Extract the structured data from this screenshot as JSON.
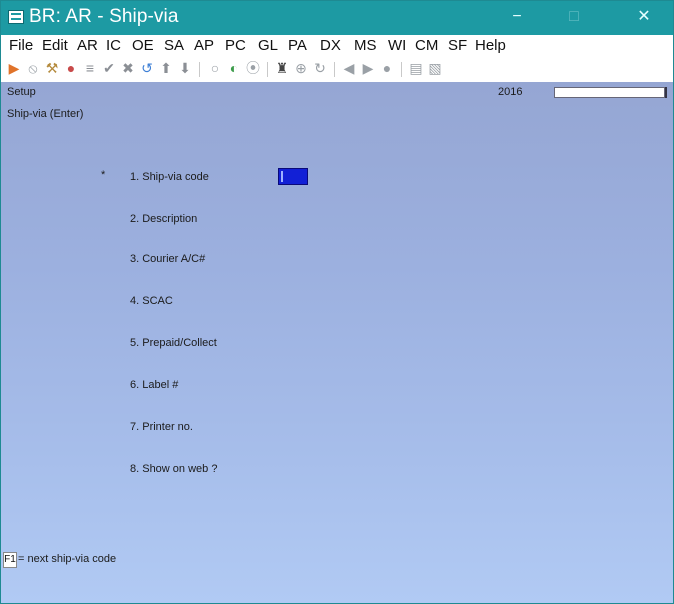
{
  "window": {
    "title": "BR: AR - Ship-via",
    "minimize_glyph": "−",
    "maximize_glyph": "□",
    "close_glyph": "✕"
  },
  "menu": [
    "File",
    "Edit",
    "AR",
    "IC",
    "OE",
    "SA",
    "AP",
    "PC",
    "GL",
    "PA",
    "DX",
    "MS",
    "WI",
    "CM",
    "SF",
    "Help"
  ],
  "toolbar_icons": [
    {
      "name": "run-icon",
      "glyph": "▶",
      "color": "#e0732a"
    },
    {
      "name": "cancel-icon",
      "glyph": "⦸",
      "color": "#9aa0a6"
    },
    {
      "name": "tools-icon",
      "glyph": "⚒",
      "color": "#b48a3c"
    },
    {
      "name": "globe-icon",
      "glyph": "●",
      "color": "#c84a4a"
    },
    {
      "name": "list-icon",
      "glyph": "≡",
      "color": "#8b8f95"
    },
    {
      "name": "check-icon",
      "glyph": "✔",
      "color": "#8b8f95"
    },
    {
      "name": "delete-icon",
      "glyph": "✖",
      "color": "#8b8f95"
    },
    {
      "name": "undo-icon",
      "glyph": "↺",
      "color": "#3d7fd6"
    },
    {
      "name": "arrow-up-icon",
      "glyph": "⬆",
      "color": "#8b8f95"
    },
    {
      "name": "arrow-down-icon",
      "glyph": "⬇",
      "color": "#8b8f95"
    },
    {
      "name": "circle-icon",
      "glyph": "○",
      "color": "#9aa0a6"
    },
    {
      "name": "refresh-icon",
      "glyph": "◐",
      "color": "#3c9c4a"
    },
    {
      "name": "stop-icon",
      "glyph": "⦿",
      "color": "#9aa0a6"
    },
    {
      "name": "binoculars-icon",
      "glyph": "♜",
      "color": "#444"
    },
    {
      "name": "zoom-icon",
      "glyph": "⊕",
      "color": "#9aa0a6"
    },
    {
      "name": "reload-icon",
      "glyph": "↻",
      "color": "#9aa0a6"
    },
    {
      "name": "prev-icon",
      "glyph": "◀",
      "color": "#9aa0a6"
    },
    {
      "name": "next-icon",
      "glyph": "▶",
      "color": "#9aa0a6"
    },
    {
      "name": "record-icon",
      "glyph": "●",
      "color": "#9aa0a6"
    },
    {
      "name": "save-icon",
      "glyph": "▤",
      "color": "#9aa0a6"
    },
    {
      "name": "export-icon",
      "glyph": "▧",
      "color": "#9aa0a6"
    }
  ],
  "header": {
    "left": "Setup",
    "year": "2016"
  },
  "mode": "Ship-via (Enter)",
  "required_marker": "*",
  "fields": [
    "1. Ship-via code",
    "2. Description",
    "3. Courier A/C#",
    "4. SCAC",
    "5. Prepaid/Collect",
    "6. Label #",
    "7. Printer no.",
    "8. Show on web ?"
  ],
  "footer": {
    "key": "F1",
    "text": "= next ship-via code"
  }
}
